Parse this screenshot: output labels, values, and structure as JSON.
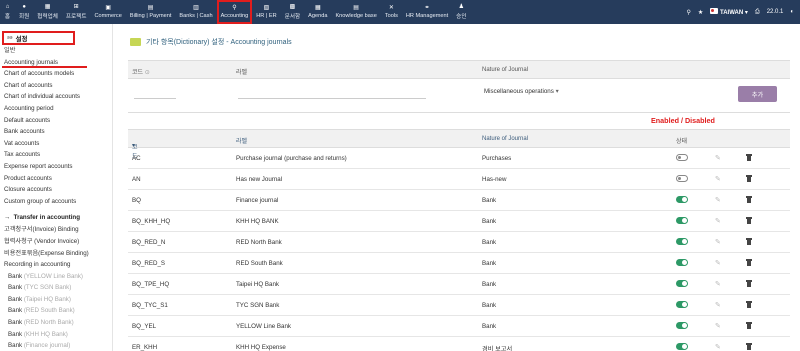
{
  "nav": {
    "items": [
      {
        "label": "홈",
        "icon": "home-icon",
        "glyph": "⌂"
      },
      {
        "label": "회원",
        "icon": "user-icon",
        "glyph": "●"
      },
      {
        "label": "협력업체",
        "icon": "building-icon",
        "glyph": "▦"
      },
      {
        "label": "프로젝트",
        "icon": "sitemap-icon",
        "glyph": "⊞"
      },
      {
        "label": "Commerce",
        "icon": "briefcase-icon",
        "glyph": "▣"
      },
      {
        "label": "Billing | Payment",
        "icon": "invoice-icon",
        "glyph": "▤"
      },
      {
        "label": "Banks | Cash",
        "icon": "bank-icon",
        "glyph": "▥"
      },
      {
        "label": "Accounting",
        "icon": "search-dollar-icon",
        "glyph": "⚲"
      },
      {
        "label": "HR | ER",
        "icon": "id-card-icon",
        "glyph": "▧"
      },
      {
        "label": "문서함",
        "icon": "folder-icon",
        "glyph": "▩"
      },
      {
        "label": "Agenda",
        "icon": "calendar-icon",
        "glyph": "▦"
      },
      {
        "label": "Knowledge base",
        "icon": "book-icon",
        "glyph": "▤"
      },
      {
        "label": "Tools",
        "icon": "wrench-icon",
        "glyph": "✕"
      },
      {
        "label": "HR Management",
        "icon": "people-icon",
        "glyph": "⚭"
      },
      {
        "label": "승인",
        "icon": "approval-icon",
        "glyph": "♟"
      }
    ],
    "active_index": 7,
    "company": "TAIWAN",
    "version": "22.0.1"
  },
  "sidebar": {
    "heading": "설정",
    "heading_icon_text": "ǝǝ",
    "items": [
      "일반",
      "Accounting journals",
      "Chart of accounts models",
      "Chart of accounts",
      "Chart of individual accounts",
      "Accounting period",
      "Default accounts",
      "Bank accounts",
      "Vat accounts",
      "Tax accounts",
      "Expense report accounts",
      "Product accounts",
      "Closure accounts",
      "Custom group of accounts"
    ],
    "active_index": 1,
    "section_title": "Transfer in accounting",
    "section_items": [
      "고객청구서(Invoice) Binding",
      "협력사청구 (Vendor Invoice)",
      "비용전표묶음(Expense Binding)",
      "Recording in accounting"
    ],
    "bank_items": [
      {
        "prefix": "Bank",
        "suffix": "(YELLOW Line Bank)"
      },
      {
        "prefix": "Bank",
        "suffix": "(TYC SGN Bank)"
      },
      {
        "prefix": "Bank",
        "suffix": "(Taipei HQ Bank)"
      },
      {
        "prefix": "Bank",
        "suffix": "(RED South Bank)"
      },
      {
        "prefix": "Bank",
        "suffix": "(RED North Bank)"
      },
      {
        "prefix": "Bank",
        "suffix": "(KHH HQ Bank)"
      },
      {
        "prefix": "Bank",
        "suffix": "(Finance journal)"
      }
    ]
  },
  "page": {
    "title": "기타 항목(Dictionary) 설정 - Accounting journals"
  },
  "form": {
    "col_code": "코드",
    "col_label": "라벨",
    "col_nature": "Nature of Journal",
    "nature_value": "Miscellaneous operations",
    "add_button": "추가"
  },
  "annotation": "Enabled / Disabled",
  "list": {
    "col_code": "코드",
    "col_label": "라벨",
    "col_nature": "Nature of Journal",
    "col_status": "상태",
    "rows": [
      {
        "code": "AC",
        "label": "Purchase journal (purchase and returns)",
        "nature": "Purchases",
        "enabled": false
      },
      {
        "code": "AN",
        "label": "Has new Journal",
        "nature": "Has-new",
        "enabled": false
      },
      {
        "code": "BQ",
        "label": "Finance journal",
        "nature": "Bank",
        "enabled": true
      },
      {
        "code": "BQ_KHH_HQ",
        "label": "KHH HQ BANK",
        "nature": "Bank",
        "enabled": true
      },
      {
        "code": "BQ_RED_N",
        "label": "RED North Bank",
        "nature": "Bank",
        "enabled": true
      },
      {
        "code": "BQ_RED_S",
        "label": "RED South Bank",
        "nature": "Bank",
        "enabled": true
      },
      {
        "code": "BQ_TPE_HQ",
        "label": "Taipei HQ Bank",
        "nature": "Bank",
        "enabled": true
      },
      {
        "code": "BQ_TYC_S1",
        "label": "TYC SGN Bank",
        "nature": "Bank",
        "enabled": true
      },
      {
        "code": "BQ_YEL",
        "label": "YELLOW Line Bank",
        "nature": "Bank",
        "enabled": true
      },
      {
        "code": "ER_KHH",
        "label": "KHH HQ Expense",
        "nature": "경비 보고서",
        "enabled": true
      }
    ]
  }
}
